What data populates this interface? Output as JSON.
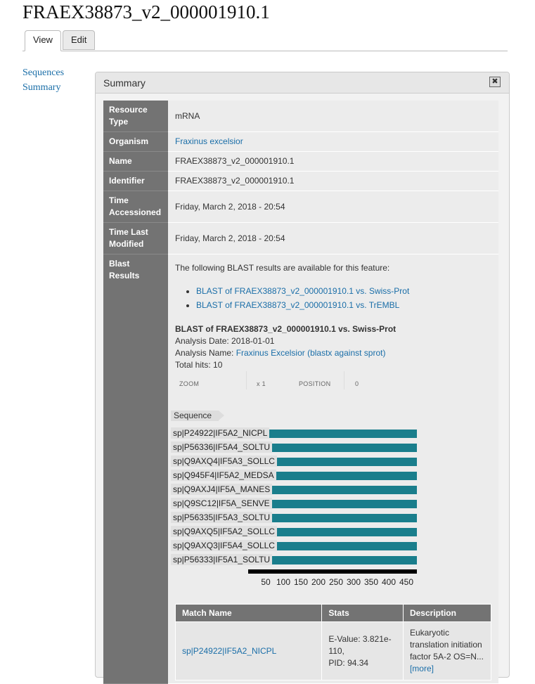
{
  "page": {
    "title": "FRAEX38873_v2_000001910.1",
    "tabs": [
      {
        "label": "View"
      },
      {
        "label": "Edit"
      }
    ]
  },
  "left_nav": [
    "Sequences",
    "Summary"
  ],
  "panel": {
    "title": "Summary",
    "close_glyph": "✖"
  },
  "properties": {
    "resource_type": {
      "label": "Resource Type",
      "value": "mRNA"
    },
    "organism": {
      "label": "Organism",
      "value": "Fraxinus excelsior"
    },
    "name": {
      "label": "Name",
      "value": "FRAEX38873_v2_000001910.1"
    },
    "identifier": {
      "label": "Identifier",
      "value": "FRAEX38873_v2_000001910.1"
    },
    "time_accessed": {
      "label": "Time Accessioned",
      "value": "Friday, March 2, 2018 - 20:54"
    },
    "time_modified": {
      "label": "Time Last Modified",
      "value": "Friday, March 2, 2018 - 20:54"
    },
    "blast": {
      "label": "Blast Results"
    }
  },
  "blast": {
    "intro": "The following BLAST results are available for this feature:",
    "links": [
      "BLAST of FRAEX38873_v2_000001910.1 vs. Swiss-Prot",
      "BLAST of FRAEX38873_v2_000001910.1 vs. TrEMBL"
    ],
    "heading": "BLAST of FRAEX38873_v2_000001910.1 vs. Swiss-Prot",
    "analysis_date_label": "Analysis Date:",
    "analysis_date": "2018-01-01",
    "analysis_name_label": "Analysis Name:",
    "analysis_name": "Fraxinus Excelsior (blastx against sprot)",
    "total_hits_label": "Total hits:",
    "total_hits": "10"
  },
  "viewer": {
    "zoom_label": "ZOOM",
    "zoom_value": "x 1",
    "position_label": "POSITION",
    "position_value": "0",
    "sequence_label": "Sequence",
    "hits": [
      {
        "name": "sp|P24922|IF5A2_NICPL",
        "start": 1,
        "end": 480
      },
      {
        "name": "sp|P56336|IF5A4_SOLTU",
        "start": 1,
        "end": 480
      },
      {
        "name": "sp|Q9AXQ4|IF5A3_SOLLC",
        "start": 1,
        "end": 480
      },
      {
        "name": "sp|Q945F4|IF5A2_MEDSA",
        "start": 1,
        "end": 480
      },
      {
        "name": "sp|Q9AXJ4|IF5A_MANES",
        "start": 1,
        "end": 480
      },
      {
        "name": "sp|Q9SC12|IF5A_SENVE",
        "start": 1,
        "end": 480
      },
      {
        "name": "sp|P56335|IF5A3_SOLTU",
        "start": 1,
        "end": 480
      },
      {
        "name": "sp|Q9AXQ5|IF5A2_SOLLC",
        "start": 1,
        "end": 480
      },
      {
        "name": "sp|Q9AXQ3|IF5A4_SOLLC",
        "start": 1,
        "end": 480
      },
      {
        "name": "sp|P56333|IF5A1_SOLTU",
        "start": 1,
        "end": 480
      }
    ],
    "axis_ticks": [
      "50",
      "100",
      "150",
      "200",
      "250",
      "300",
      "350",
      "400",
      "450"
    ],
    "bar_color": "#1a7e8c"
  },
  "results": {
    "headers": [
      "Match Name",
      "Stats",
      "Description"
    ],
    "rows": [
      {
        "match": "sp|P24922|IF5A2_NICPL",
        "evalue": "E-Value: 3.821e-110,",
        "pid": "PID: 94.34",
        "description": "Eukaryotic translation initiation factor 5A-2 OS=N...",
        "more": "[more]"
      }
    ]
  }
}
